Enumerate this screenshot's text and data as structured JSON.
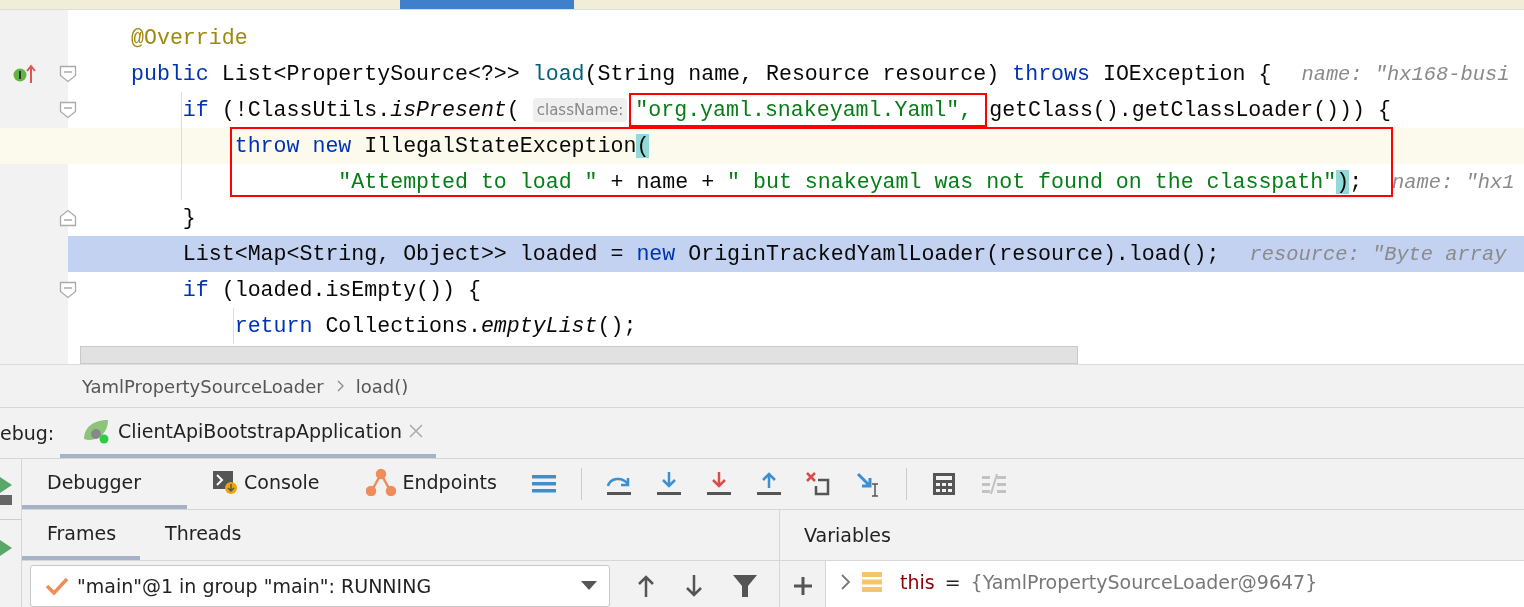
{
  "editor": {
    "lines": [
      {
        "caret_line": false,
        "execution_line": false,
        "boxed": false,
        "tokens": [
          {
            "text": "@Override",
            "kind": "annotation"
          }
        ]
      },
      {
        "caret_line": false,
        "execution_line": false,
        "boxed": false,
        "tokens": [
          {
            "text": "public",
            "kind": "keyword"
          },
          {
            "text": " List<PropertySource<?>> ",
            "kind": "plain"
          },
          {
            "text": "load",
            "kind": "method"
          },
          {
            "text": "(String name, Resource resource) ",
            "kind": "plain"
          },
          {
            "text": "throws",
            "kind": "keyword"
          },
          {
            "text": " IOException {",
            "kind": "plain"
          },
          {
            "text": "name: \"hx168-busi",
            "kind": "inline-value"
          }
        ]
      },
      {
        "caret_line": false,
        "execution_line": false,
        "boxed": false,
        "tokens": [
          {
            "text": "    if",
            "kind": "keyword"
          },
          {
            "text": " (!ClassUtils.",
            "kind": "plain"
          },
          {
            "text": "isPresent",
            "kind": "italic"
          },
          {
            "text": "( ",
            "kind": "plain"
          },
          {
            "text": "className:",
            "kind": "hint"
          },
          {
            "text": "\"org.yaml.snakeyaml.Yaml\", ",
            "kind": "string",
            "boxed": true
          },
          {
            "text": "getClass().getClassLoader())) {",
            "kind": "plain"
          }
        ]
      },
      {
        "caret_line": true,
        "execution_line": false,
        "boxed": true,
        "tokens": [
          {
            "text": "        throw new",
            "kind": "keyword"
          },
          {
            "text": " IllegalStateException",
            "kind": "plain"
          },
          {
            "text": "(",
            "kind": "brace-match"
          }
        ]
      },
      {
        "caret_line": false,
        "execution_line": false,
        "boxed": true,
        "tokens": [
          {
            "text": "                \"Attempted to load \"",
            "kind": "string"
          },
          {
            "text": " + name + ",
            "kind": "plain"
          },
          {
            "text": "\" but snakeyaml was not found on the classpath\"",
            "kind": "string"
          },
          {
            "text": ")",
            "kind": "brace-match"
          },
          {
            "text": ";",
            "kind": "plain"
          },
          {
            "text": "name: \"hx1",
            "kind": "inline-value"
          }
        ]
      },
      {
        "caret_line": false,
        "execution_line": false,
        "boxed": false,
        "tokens": [
          {
            "text": "    }",
            "kind": "plain"
          }
        ]
      },
      {
        "caret_line": false,
        "execution_line": true,
        "boxed": false,
        "tokens": [
          {
            "text": "    List<Map<String, Object>> loaded = ",
            "kind": "plain"
          },
          {
            "text": "new",
            "kind": "keyword"
          },
          {
            "text": " OriginTrackedYamlLoader(resource).load();",
            "kind": "plain"
          },
          {
            "text": "resource: \"Byte array",
            "kind": "inline-value"
          }
        ]
      },
      {
        "caret_line": false,
        "execution_line": false,
        "boxed": false,
        "tokens": [
          {
            "text": "    if",
            "kind": "keyword"
          },
          {
            "text": " (loaded.isEmpty()) {",
            "kind": "plain"
          }
        ]
      },
      {
        "caret_line": false,
        "execution_line": false,
        "boxed": false,
        "tokens": [
          {
            "text": "        return",
            "kind": "keyword"
          },
          {
            "text": " Collections.",
            "kind": "plain"
          },
          {
            "text": "emptyList",
            "kind": "italic"
          },
          {
            "text": "();",
            "kind": "plain"
          }
        ]
      }
    ]
  },
  "breadcrumbs": [
    "YamlPropertySourceLoader",
    "load()"
  ],
  "debug": {
    "label": "ebug:",
    "session_tab": {
      "title": "ClientApiBootstrapApplication",
      "selected": true
    },
    "tabs": [
      {
        "label": "Debugger",
        "selected": true
      },
      {
        "label": "Console",
        "selected": false
      },
      {
        "label": "Endpoints",
        "selected": false
      }
    ],
    "toolbar_groups": [
      [
        {
          "kind": "menu",
          "disabled": false
        }
      ],
      [
        {
          "kind": "step-over",
          "disabled": false
        },
        {
          "kind": "step-into",
          "disabled": false
        },
        {
          "kind": "force-step-into",
          "disabled": false
        },
        {
          "kind": "step-out",
          "disabled": false
        },
        {
          "kind": "drop-frame",
          "disabled": false
        },
        {
          "kind": "run-to-cursor",
          "disabled": false
        }
      ],
      [
        {
          "kind": "evaluate",
          "disabled": false
        },
        {
          "kind": "trace",
          "disabled": true
        }
      ]
    ],
    "frame_tabs": [
      {
        "label": "Frames",
        "selected": true
      },
      {
        "label": "Threads",
        "selected": false
      }
    ],
    "thread_select": {
      "value": "\"main\"@1 in group \"main\": RUNNING"
    },
    "variables": {
      "title": "Variables",
      "items": [
        {
          "name": "this",
          "operator": "=",
          "value": "{YamlPropertySourceLoader@9647}",
          "expanded": false
        }
      ]
    }
  }
}
